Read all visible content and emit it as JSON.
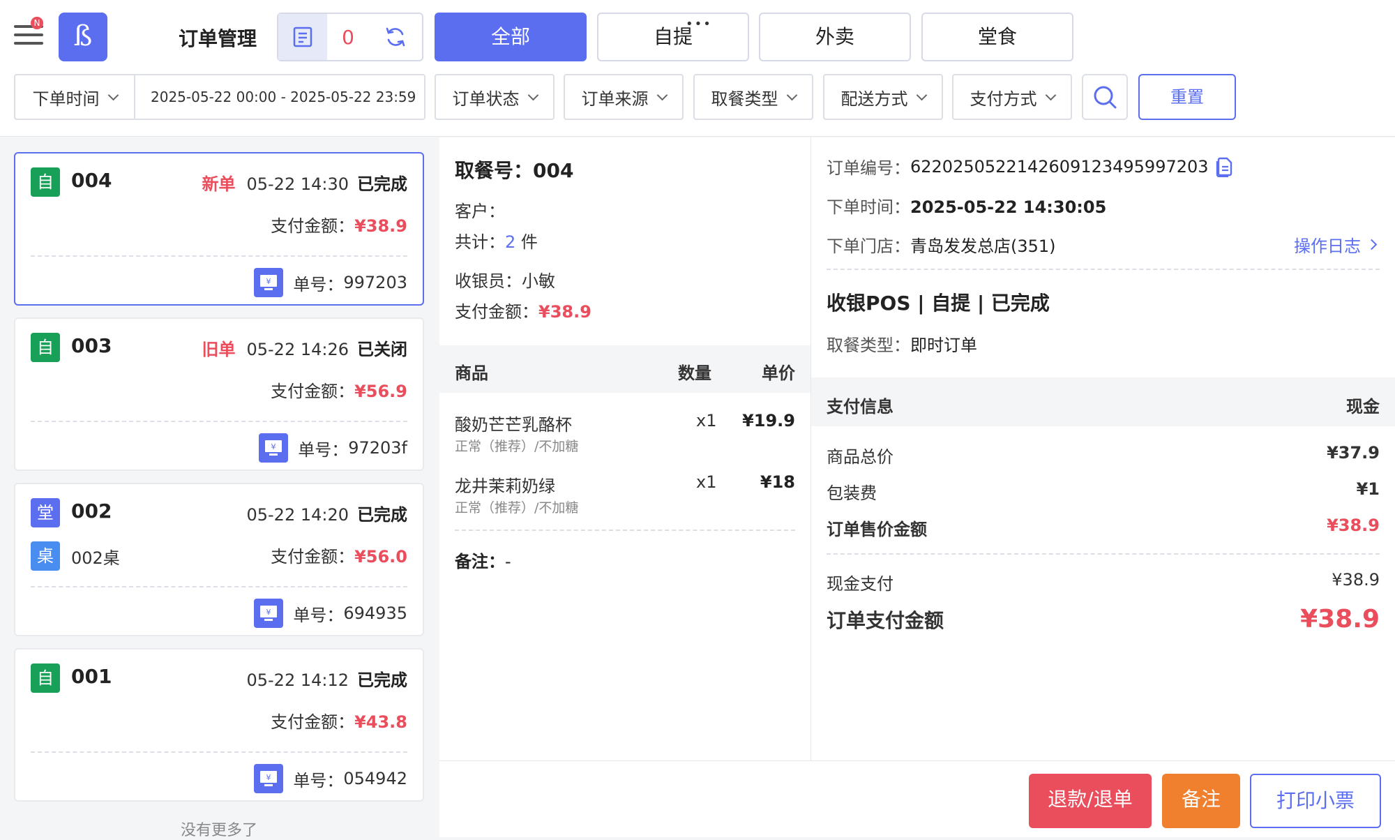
{
  "header": {
    "notification_badge": "N",
    "app_logo_glyph": "ß",
    "page_title": "订单管理",
    "pending_count": "0",
    "tabs": [
      {
        "label": "全部",
        "active": true
      },
      {
        "label": "自提",
        "active": false
      },
      {
        "label": "外卖",
        "active": false
      },
      {
        "label": "堂食",
        "active": false
      }
    ]
  },
  "filters": {
    "date_label": "下单时间",
    "date_range": "2025-05-22 00:00 - 2025-05-22 23:59",
    "dropdowns": [
      "订单状态",
      "订单来源",
      "取餐类型",
      "配送方式",
      "支付方式"
    ],
    "reset_label": "重置"
  },
  "orders": [
    {
      "type_badge": "自",
      "badge_color": "#18a058",
      "number": "004",
      "tag": "新单",
      "time": "05-22 14:30",
      "status": "已完成",
      "pay_label": "支付金额：",
      "pay_amount": "¥38.9",
      "ticket_label": "单号：",
      "ticket_no": "997203",
      "selected": true
    },
    {
      "type_badge": "自",
      "badge_color": "#18a058",
      "number": "003",
      "tag": "旧单",
      "time": "05-22 14:26",
      "status": "已关闭",
      "pay_label": "支付金额：",
      "pay_amount": "¥56.9",
      "ticket_label": "单号：",
      "ticket_no": "97203f"
    },
    {
      "type_badge": "堂",
      "badge_color": "#5b6ef0",
      "number": "002",
      "tag": "",
      "time": "05-22 14:20",
      "status": "已完成",
      "table_badge": "桌",
      "table_name": "002桌",
      "pay_label": "支付金额：",
      "pay_amount": "¥56.0",
      "ticket_label": "单号：",
      "ticket_no": "694935"
    },
    {
      "type_badge": "自",
      "badge_color": "#18a058",
      "number": "001",
      "tag": "",
      "time": "05-22 14:12",
      "status": "已完成",
      "pay_label": "支付金额：",
      "pay_amount": "¥43.8",
      "ticket_label": "单号：",
      "ticket_no": "054942"
    }
  ],
  "no_more_text": "没有更多了",
  "detail": {
    "pickup_label": "取餐号：",
    "pickup_no": "004",
    "customer_label": "客户：",
    "customer": "",
    "total_label": "共计：",
    "total_count": "2",
    "total_unit": "件",
    "cashier_label": "收银员：",
    "cashier": "小敏",
    "pay_label": "支付金额：",
    "pay_amount": "¥38.9",
    "goods_headers": {
      "name": "商品",
      "qty": "数量",
      "price": "单价"
    },
    "goods": [
      {
        "name": "酸奶芒芒乳酪杯",
        "spec": "正常（推荐）/不加糖",
        "qty": "x1",
        "price": "¥19.9"
      },
      {
        "name": "龙井茉莉奶绿",
        "spec": "正常（推荐）/不加糖",
        "qty": "x1",
        "price": "¥18"
      }
    ],
    "note_label": "备注：",
    "note": "-"
  },
  "info": {
    "order_id_label": "订单编号：",
    "order_id": "6220250522142609123495997203",
    "order_time_label": "下单时间：",
    "order_time": "2025-05-22 14:30:05",
    "store_label": "下单门店：",
    "store": "青岛发发总店(351)",
    "log_link": "操作日志",
    "channel_line": "收银POS | 自提 | 已完成",
    "pickup_type_label": "取餐类型：",
    "pickup_type": "即时订单",
    "pay_info_label": "支付信息",
    "pay_method": "现金",
    "rows": [
      {
        "label": "商品总价",
        "value": "¥37.9"
      },
      {
        "label": "包装费",
        "value": "¥1"
      },
      {
        "label": "订单售价金额",
        "value": "¥38.9"
      }
    ],
    "cash_label": "现金支付",
    "cash_value": "¥38.9",
    "final_label": "订单支付金额",
    "final_value": "¥38.9"
  },
  "actions": {
    "refund": "退款/退单",
    "note": "备注",
    "print": "打印小票"
  },
  "colors": {
    "accent": "#5b6ef0",
    "danger": "#ea4d5c",
    "warning": "#f07f2e",
    "success": "#18a058"
  }
}
